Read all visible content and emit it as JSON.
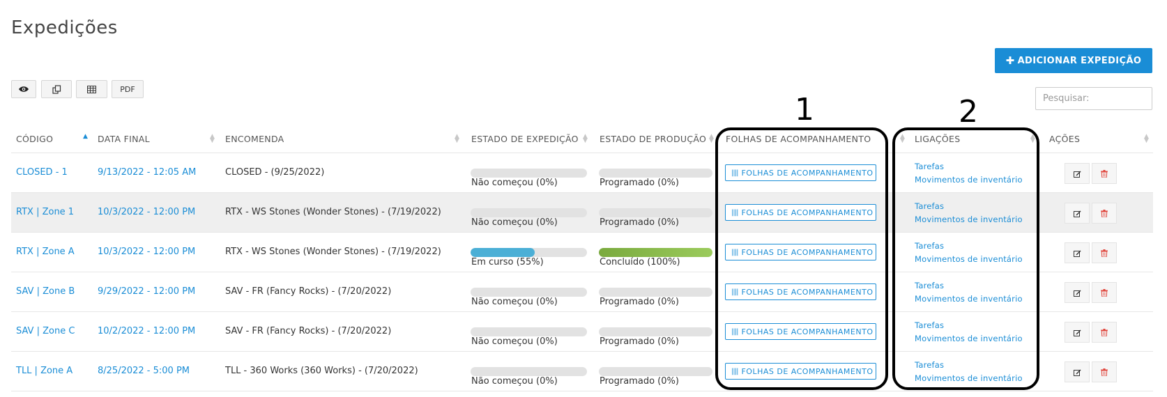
{
  "page": {
    "title": "Expedições",
    "add_button_label": "ADICIONAR EXPEDIÇÃO",
    "add_button_icon": "plus-icon",
    "search_placeholder": "Pesquisar:"
  },
  "toolbar": {
    "buttons": [
      {
        "icon": "eye-icon",
        "label": ""
      },
      {
        "icon": "copy-icon",
        "label": ""
      },
      {
        "icon": "table-icon",
        "label": ""
      },
      {
        "icon": "",
        "label": "PDF"
      }
    ]
  },
  "table": {
    "columns": [
      "CÓDIGO",
      "DATA FINAL",
      "ENCOMENDA",
      "ESTADO DE EXPEDIÇÃO",
      "ESTADO DE PRODUÇÃO",
      "FOLHAS DE ACOMPANHAMENTO",
      "LIGAÇÕES",
      "AÇÕES"
    ],
    "sorted_column": "CÓDIGO",
    "rows": [
      {
        "code": "CLOSED - 1",
        "date": "9/13/2022 - 12:05 AM",
        "order": "CLOSED - (9/25/2022)",
        "exp_label": "Não começou (0%)",
        "exp_pct": 0,
        "prod_label": "Programado (0%)",
        "prod_pct": 0,
        "sheet_btn": "FOLHAS DE ACOMPANHAMENTO",
        "link1": "Tarefas",
        "link2": "Movimentos de inventário"
      },
      {
        "code": "RTX | Zone 1",
        "date": "10/3/2022 - 12:00 PM",
        "order": "RTX - WS Stones (Wonder Stones) - (7/19/2022)",
        "exp_label": "Não começou (0%)",
        "exp_pct": 0,
        "prod_label": "Programado (0%)",
        "prod_pct": 0,
        "sheet_btn": "FOLHAS DE ACOMPANHAMENTO",
        "link1": "Tarefas",
        "link2": "Movimentos de inventário"
      },
      {
        "code": "RTX | Zone A",
        "date": "10/3/2022 - 12:00 PM",
        "order": "RTX - WS Stones (Wonder Stones) - (7/19/2022)",
        "exp_label": "Em curso (55%)",
        "exp_pct": 55,
        "prod_label": "Concluído (100%)",
        "prod_pct": 100,
        "sheet_btn": "FOLHAS DE ACOMPANHAMENTO",
        "link1": "Tarefas",
        "link2": "Movimentos de inventário"
      },
      {
        "code": "SAV | Zone B",
        "date": "9/29/2022 - 12:00 PM",
        "order": "SAV - FR (Fancy Rocks) - (7/20/2022)",
        "exp_label": "Não começou (0%)",
        "exp_pct": 0,
        "prod_label": "Programado (0%)",
        "prod_pct": 0,
        "sheet_btn": "FOLHAS DE ACOMPANHAMENTO",
        "link1": "Tarefas",
        "link2": "Movimentos de inventário"
      },
      {
        "code": "SAV | Zone C",
        "date": "10/2/2022 - 12:00 PM",
        "order": "SAV - FR (Fancy Rocks) - (7/20/2022)",
        "exp_label": "Não começou (0%)",
        "exp_pct": 0,
        "prod_label": "Programado (0%)",
        "prod_pct": 0,
        "sheet_btn": "FOLHAS DE ACOMPANHAMENTO",
        "link1": "Tarefas",
        "link2": "Movimentos de inventário"
      },
      {
        "code": "TLL | Zone A",
        "date": "8/25/2022 - 5:00 PM",
        "order": "TLL - 360 Works (360 Works) - (7/20/2022)",
        "exp_label": "Não começou (0%)",
        "exp_pct": 0,
        "prod_label": "Programado (0%)",
        "prod_pct": 0,
        "sheet_btn": "FOLHAS DE ACOMPANHAMENTO",
        "link1": "Tarefas",
        "link2": "Movimentos de inventário"
      }
    ]
  },
  "annotations": [
    {
      "number": "1",
      "target": "FOLHAS DE ACOMPANHAMENTO"
    },
    {
      "number": "2",
      "target": "LIGAÇÕES"
    }
  ],
  "colors": {
    "accent": "#1a8dd6",
    "progress_blue": "#4bafd6",
    "progress_green": "#8bbb4c",
    "delete_red": "#e0453c"
  }
}
